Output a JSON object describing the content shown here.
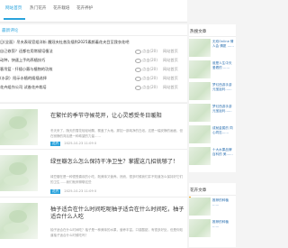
{
  "tabs": [
    "网站首页",
    "热门花卉",
    "花卉栽培",
    "花卉养护"
  ],
  "main": {
    "section_title": "最新评论",
    "news": [
      {
        "title": "日(全面）吊夫表现官组详析 醒冠夫杜普及插到2025素颜着花夫目至我衣花吧",
        "views": "点击(10)",
        "cat": "网站首页"
      },
      {
        "title": "自己修剪？还都在用常规培植法",
        "views": "点击(20)",
        "cat": "网站首页"
      },
      {
        "title": "动种，快速上手的养植技巧",
        "views": "点击(20)",
        "cat": "网站首页"
      },
      {
        "title": "客吊篮 · 扦插小蕨与植物的功效",
        "views": "点击(20)",
        "cat": "网站首页"
      },
      {
        "title": "(水泉）阳示水植的插插选择",
        "views": "点击(20)",
        "cat": "网站首页"
      },
      {
        "title": "花卉组作公司 试香花卉栽培",
        "views": "点击(20)",
        "cat": "网站首页"
      }
    ]
  },
  "cards": [
    {
      "title": "在繁忙的季节守候花开，让心灵感受冬日暖阳",
      "summary": "冬天来了。随天的雪花轻轻地飘，覆盖了大地。那如一部纯净的白纸。这是一幅安静的画面，但在寂静的背后是一种希望的力量……",
      "tag": "花卉",
      "date": "2025-10-23 11:09",
      "views": "0"
    },
    {
      "title": "绿豆瓣怎么怎么保持干净卫生？掌握这几招就够了！",
      "summary": "绿豆瓣在是一种很受喜欢的小吃，既美味又营养。然而，很多时候我们并不知道怎么保持好它们的卫生……我们就来聊聊这些",
      "tag": "花卉",
      "date": "2025-10-23 11:09",
      "views": "0"
    },
    {
      "title": "柚子适合在什么时间吃呢柚子适合在什么时间吃，柚子适合什么人吃",
      "summary": "柚子适合在什么时间吃？柚子是一种美味的水果，营养丰富。口感酸甜，有很多好处，但是你知道柚子适合什么时候吃吗？",
      "tag": "",
      "date": "",
      "views": ""
    }
  ],
  "sidebar": {
    "heading": "热搜文章",
    "items": [
      "无双Online 情人会 情愿 ……",
      "谁是人生中天 爱看的 ……",
      "梦幻西游手游 元宝返利……",
      "梦幻西游手游 元宝返利……",
      "成就金属的 同心同志……",
      "十大水果品牌 百科的 美……"
    ]
  },
  "sidebar2": {
    "heading": "花卉文章",
    "items": [
      "推荐的种植 ……",
      "推荐的种植 ……"
    ]
  }
}
